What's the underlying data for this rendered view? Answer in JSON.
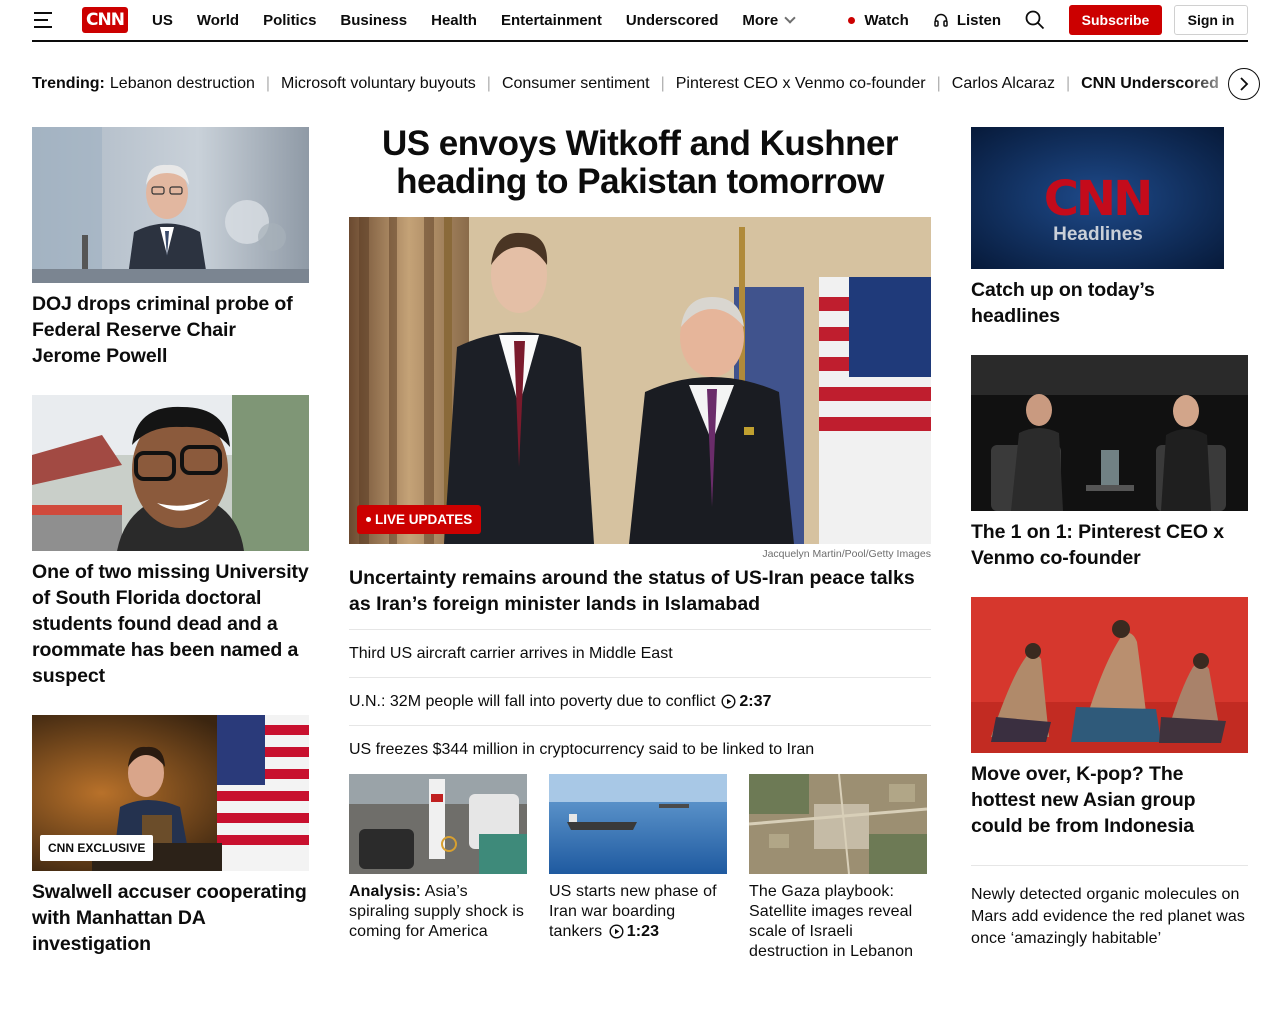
{
  "nav": {
    "items": [
      "US",
      "World",
      "Politics",
      "Business",
      "Health",
      "Entertainment",
      "Underscored"
    ],
    "more": "More",
    "watch": "Watch",
    "listen": "Listen",
    "subscribe": "Subscribe",
    "signin": "Sign in"
  },
  "trending": {
    "label": "Trending:",
    "items": [
      "Lebanon destruction",
      "Microsoft voluntary buyouts",
      "Consumer sentiment",
      "Pinterest CEO x Venmo co-founder",
      "Carlos Alcaraz",
      "CNN Underscored"
    ]
  },
  "left": [
    {
      "title": "DOJ drops criminal probe of Federal Reserve Chair Jerome Powell"
    },
    {
      "title": "One of two missing University of South Florida doctoral students found dead and a roommate has been named a suspect"
    },
    {
      "title": "Swalwell accuser cooperating with Manhattan DA investigation",
      "badge": "CNN EXCLUSIVE"
    }
  ],
  "lead": {
    "headline": "US envoys Witkoff and Kushner heading to Pakistan tomorrow",
    "badge": "LIVE UPDATES",
    "credit": "Jacquelyn Martin/Pool/Getty Images",
    "sub": "Uncertainty remains around the status of US-Iran peace talks as Iran’s foreign minister lands in Islamabad",
    "list": [
      {
        "text": "Third US aircraft carrier arrives in Middle East"
      },
      {
        "text": "U.N.: 32M people will fall into poverty due to conflict",
        "duration": "2:37"
      },
      {
        "text": "US freezes $344 million in cryptocurrency said to be linked to Iran"
      }
    ],
    "thumbs": [
      {
        "prefix": "Analysis:",
        "text": " Asia’s spiraling supply shock is coming for America"
      },
      {
        "text": "US starts new phase of Iran war boarding tankers",
        "duration": "1:23"
      },
      {
        "text": "The Gaza playbook: Satellite images reveal scale of Israeli destruction in Lebanon"
      }
    ]
  },
  "right": {
    "promo_logo": "CNN",
    "promo_label": "Headlines",
    "cards": [
      {
        "title": "Catch up on today’s headlines"
      },
      {
        "title": "The 1 on 1: Pinterest CEO x Venmo co-founder"
      },
      {
        "title": "Move over, K-pop? The hottest new Asian group could be from Indonesia"
      }
    ],
    "small": "Newly detected organic molecules on Mars add evidence the red planet was once ‘amazingly habitable’"
  },
  "colors": {
    "brand": "#cc0000",
    "text": "#0c0c0c",
    "muted": "#6e6e6e"
  }
}
